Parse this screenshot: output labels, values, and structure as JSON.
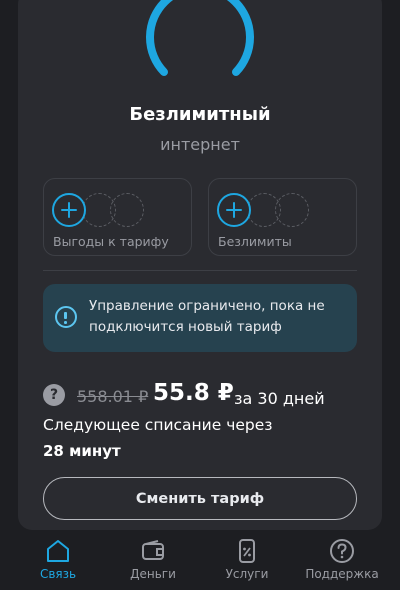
{
  "tariff": {
    "title": "Безлимитный",
    "subtitle": "интернет"
  },
  "tiles": [
    {
      "label": "Выгоды к тарифу",
      "icon": "plus-icon"
    },
    {
      "label": "Безлимиты",
      "icon": "plus-icon"
    }
  ],
  "notice": {
    "text": "Управление ограничено, пока не подключится новый тариф",
    "icon": "info-icon"
  },
  "price": {
    "help_icon_text": "?",
    "old": "558.01 ₽",
    "new": "55.8 ₽",
    "period": "за 30 дней",
    "next_charge_label": "Следующее списание через",
    "next_charge_value": "28 минут"
  },
  "actions": {
    "change_tariff": "Сменить тариф"
  },
  "nav": [
    {
      "label": "Связь",
      "icon": "home-icon",
      "active": true
    },
    {
      "label": "Деньги",
      "icon": "wallet-icon",
      "active": false
    },
    {
      "label": "Услуги",
      "icon": "services-icon",
      "active": false
    },
    {
      "label": "Поддержка",
      "icon": "help-circle-icon",
      "active": false
    }
  ],
  "colors": {
    "accent": "#1ea7e1",
    "background": "#1d1e22",
    "card": "#2a2b30",
    "notice_bg": "#26424f"
  }
}
